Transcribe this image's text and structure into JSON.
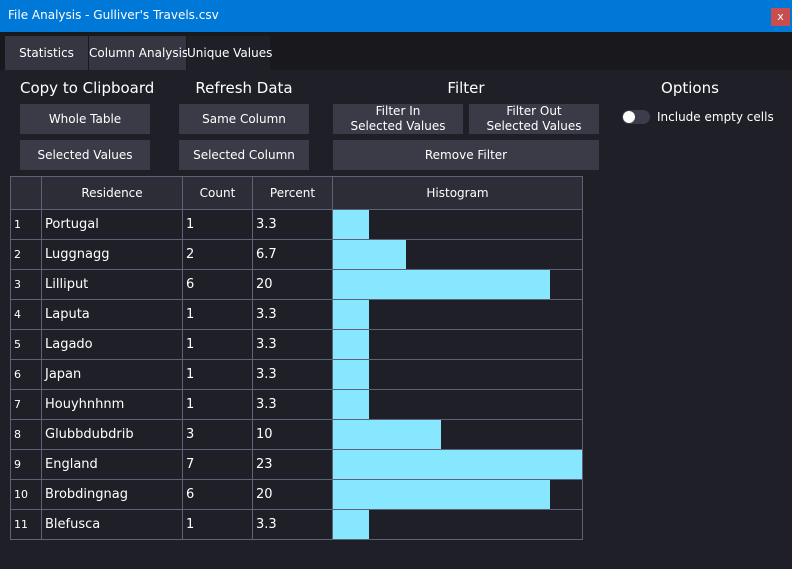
{
  "window": {
    "title": "File Analysis - Gulliver's Travels.csv",
    "close_label": "x"
  },
  "tabs": [
    {
      "label": "Statistics",
      "active": false
    },
    {
      "label": "Column Analysis",
      "active": false
    },
    {
      "label": "Unique Values",
      "active": true
    }
  ],
  "copy": {
    "title": "Copy to Clipboard",
    "whole_table": "Whole Table",
    "selected_values": "Selected Values"
  },
  "refresh": {
    "title": "Refresh Data",
    "same_column": "Same Column",
    "selected_column": "Selected Column"
  },
  "filter": {
    "title": "Filter",
    "filter_in": [
      "Filter In",
      "Selected Values"
    ],
    "filter_out": [
      "Filter Out",
      "Selected Values"
    ],
    "remove": "Remove Filter"
  },
  "options": {
    "title": "Options",
    "include_empty_label": "Include empty cells",
    "include_empty_on": false
  },
  "table": {
    "headers": {
      "residence": "Residence",
      "count": "Count",
      "percent": "Percent",
      "histogram": "Histogram"
    },
    "histogram_max_percent": 23,
    "rows": [
      {
        "idx": "1",
        "residence": "Portugal",
        "count": "1",
        "percent": "3.3"
      },
      {
        "idx": "2",
        "residence": "Luggnagg",
        "count": "2",
        "percent": "6.7"
      },
      {
        "idx": "3",
        "residence": "Lilliput",
        "count": "6",
        "percent": "20"
      },
      {
        "idx": "4",
        "residence": "Laputa",
        "count": "1",
        "percent": "3.3"
      },
      {
        "idx": "5",
        "residence": "Lagado",
        "count": "1",
        "percent": "3.3"
      },
      {
        "idx": "6",
        "residence": "Japan",
        "count": "1",
        "percent": "3.3"
      },
      {
        "idx": "7",
        "residence": "Houyhnhnm",
        "count": "1",
        "percent": "3.3"
      },
      {
        "idx": "8",
        "residence": "Glubbdubdrib",
        "count": "3",
        "percent": "10"
      },
      {
        "idx": "9",
        "residence": "England",
        "count": "7",
        "percent": "23"
      },
      {
        "idx": "10",
        "residence": "Brobdingnag",
        "count": "6",
        "percent": "20"
      },
      {
        "idx": "11",
        "residence": "Blefusca",
        "count": "1",
        "percent": "3.3"
      }
    ]
  },
  "colors": {
    "accent": "#0078d7",
    "bar": "#86e7fe",
    "background": "#1f1f27",
    "button": "#3b3b47",
    "close": "#c94d4d"
  }
}
